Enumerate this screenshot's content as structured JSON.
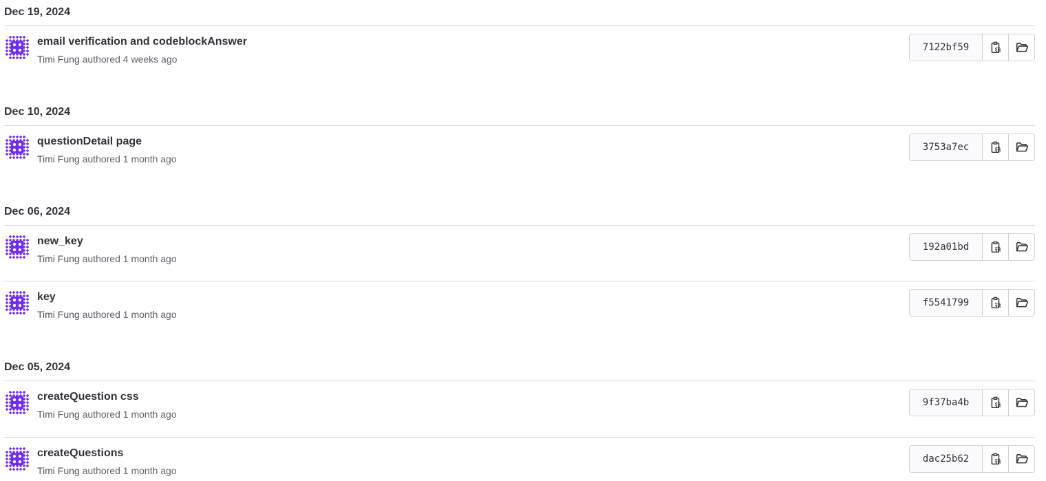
{
  "colors": {
    "avatar_primary": "#6f2bf5",
    "avatar_pattern": "#6f2bf5",
    "text_primary": "#333238",
    "text_secondary": "#626168",
    "divider": "#dcdcde"
  },
  "icons": {
    "copy": "copy-icon",
    "browse": "folder-open-icon"
  },
  "groups": [
    {
      "date": "Dec 19, 2024",
      "commits": [
        {
          "title": "email verification and codeblockAnswer",
          "author": "Timi Fung",
          "authored_text": "authored",
          "time": "4 weeks ago",
          "sha": "7122bf59"
        }
      ]
    },
    {
      "date": "Dec 10, 2024",
      "commits": [
        {
          "title": "questionDetail page",
          "author": "Timi Fung",
          "authored_text": "authored",
          "time": "1 month ago",
          "sha": "3753a7ec"
        }
      ]
    },
    {
      "date": "Dec 06, 2024",
      "commits": [
        {
          "title": "new_key",
          "author": "Timi Fung",
          "authored_text": "authored",
          "time": "1 month ago",
          "sha": "192a01bd"
        },
        {
          "title": "key",
          "author": "Timi Fung",
          "authored_text": "authored",
          "time": "1 month ago",
          "sha": "f5541799"
        }
      ]
    },
    {
      "date": "Dec 05, 2024",
      "commits": [
        {
          "title": "createQuestion css",
          "author": "Timi Fung",
          "authored_text": "authored",
          "time": "1 month ago",
          "sha": "9f37ba4b"
        },
        {
          "title": "createQuestions",
          "author": "Timi Fung",
          "authored_text": "authored",
          "time": "1 month ago",
          "sha": "dac25b62"
        }
      ]
    }
  ]
}
